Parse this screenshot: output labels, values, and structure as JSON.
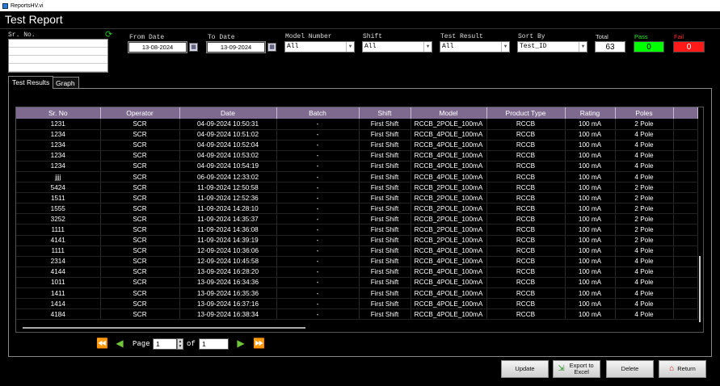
{
  "window": {
    "title": "ReportsHV.vi"
  },
  "app_title": "Test Report",
  "filters": {
    "sr_no_label": "Sr. No.",
    "from_date_label": "From Date",
    "from_date": "13-08-2024",
    "to_date_label": "To Date",
    "to_date": "13-09-2024",
    "model_label": "Model Number",
    "model_value": "All",
    "shift_label": "Shift",
    "shift_value": "All",
    "result_label": "Test Result",
    "result_value": "All",
    "sort_label": "Sort By",
    "sort_value": "Test_ID",
    "total_label": "Total",
    "total_value": "63",
    "pass_label": "Pass",
    "pass_value": "0",
    "fail_label": "Fail",
    "fail_value": "0"
  },
  "tabs": [
    {
      "label": "Test Results"
    },
    {
      "label": "Graph"
    }
  ],
  "table": {
    "columns": [
      "Sr. No",
      "Operator",
      "Date",
      "Batch",
      "Shift",
      "Model",
      "Product Type",
      "Rating",
      "Poles"
    ],
    "rows": [
      [
        "1231",
        "SCR",
        "04-09-2024 10:50:31",
        "-",
        "First Shift",
        "RCCB_2POLE_100mA",
        "RCCB",
        "100 mA",
        "2 Pole"
      ],
      [
        "1234",
        "SCR",
        "04-09-2024 10:51:02",
        "-",
        "First Shift",
        "RCCB_4POLE_100mA",
        "RCCB",
        "100 mA",
        "4 Pole"
      ],
      [
        "1234",
        "SCR",
        "04-09-2024 10:52:04",
        "-",
        "First Shift",
        "RCCB_4POLE_100mA",
        "RCCB",
        "100 mA",
        "4 Pole"
      ],
      [
        "1234",
        "SCR",
        "04-09-2024 10:53:02",
        "-",
        "First Shift",
        "RCCB_4POLE_100mA",
        "RCCB",
        "100 mA",
        "4 Pole"
      ],
      [
        "1234",
        "SCR",
        "04-09-2024 10:54:19",
        "-",
        "First Shift",
        "RCCB_4POLE_100mA",
        "RCCB",
        "100 mA",
        "4 Pole"
      ],
      [
        "jjjj",
        "SCR",
        "06-09-2024 12:33:02",
        "-",
        "First Shift",
        "RCCB_4POLE_100mA",
        "RCCB",
        "100 mA",
        "4 Pole"
      ],
      [
        "5424",
        "SCR",
        "11-09-2024 12:50:58",
        "-",
        "First Shift",
        "RCCB_2POLE_100mA",
        "RCCB",
        "100 mA",
        "2 Pole"
      ],
      [
        "1511",
        "SCR",
        "11-09-2024 12:52:36",
        "-",
        "First Shift",
        "RCCB_2POLE_100mA",
        "RCCB",
        "100 mA",
        "2 Pole"
      ],
      [
        "1555",
        "SCR",
        "11-09-2024 14:28:10",
        "-",
        "First Shift",
        "RCCB_2POLE_100mA",
        "RCCB",
        "100 mA",
        "2 Pole"
      ],
      [
        "3252",
        "SCR",
        "11-09-2024 14:35:37",
        "-",
        "First Shift",
        "RCCB_2POLE_100mA",
        "RCCB",
        "100 mA",
        "2 Pole"
      ],
      [
        "1111",
        "SCR",
        "11-09-2024 14:36:08",
        "-",
        "First Shift",
        "RCCB_2POLE_100mA",
        "RCCB",
        "100 mA",
        "2 Pole"
      ],
      [
        "4141",
        "SCR",
        "11-09-2024 14:39:19",
        "-",
        "First Shift",
        "RCCB_2POLE_100mA",
        "RCCB",
        "100 mA",
        "2 Pole"
      ],
      [
        "1111",
        "SCR",
        "12-09-2024 10:36:06",
        "-",
        "First Shift",
        "RCCB_4POLE_100mA",
        "RCCB",
        "100 mA",
        "4 Pole"
      ],
      [
        "2314",
        "SCR",
        "12-09-2024 10:45:58",
        "-",
        "First Shift",
        "RCCB_4POLE_100mA",
        "RCCB",
        "100 mA",
        "4 Pole"
      ],
      [
        "4144",
        "SCR",
        "13-09-2024 16:28:20",
        "-",
        "First Shift",
        "RCCB_4POLE_100mA",
        "RCCB",
        "100 mA",
        "4 Pole"
      ],
      [
        "1011",
        "SCR",
        "13-09-2024 16:34:36",
        "-",
        "First Shift",
        "RCCB_4POLE_100mA",
        "RCCB",
        "100 mA",
        "4 Pole"
      ],
      [
        "1411",
        "SCR",
        "13-09-2024 16:35:36",
        "-",
        "First Shift",
        "RCCB_4POLE_100mA",
        "RCCB",
        "100 mA",
        "4 Pole"
      ],
      [
        "1414",
        "SCR",
        "13-09-2024 16:37:16",
        "-",
        "First Shift",
        "RCCB_4POLE_100mA",
        "RCCB",
        "100 mA",
        "4 Pole"
      ],
      [
        "4184",
        "SCR",
        "13-09-2024 16:38:34",
        "-",
        "First Shift",
        "RCCB_4POLE_100mA",
        "RCCB",
        "100 mA",
        "4 Pole"
      ]
    ]
  },
  "pager": {
    "page_label": "Page",
    "page_value": "1",
    "of_label": "of",
    "total_pages": "1"
  },
  "buttons": {
    "update": "Update",
    "export": "Export to Excel",
    "delete": "Delete",
    "return": "Return"
  },
  "colors": {
    "pass_bg": "#00ff00",
    "fail_bg": "#ff1a1a",
    "header_bg": "#7f6a8f"
  }
}
